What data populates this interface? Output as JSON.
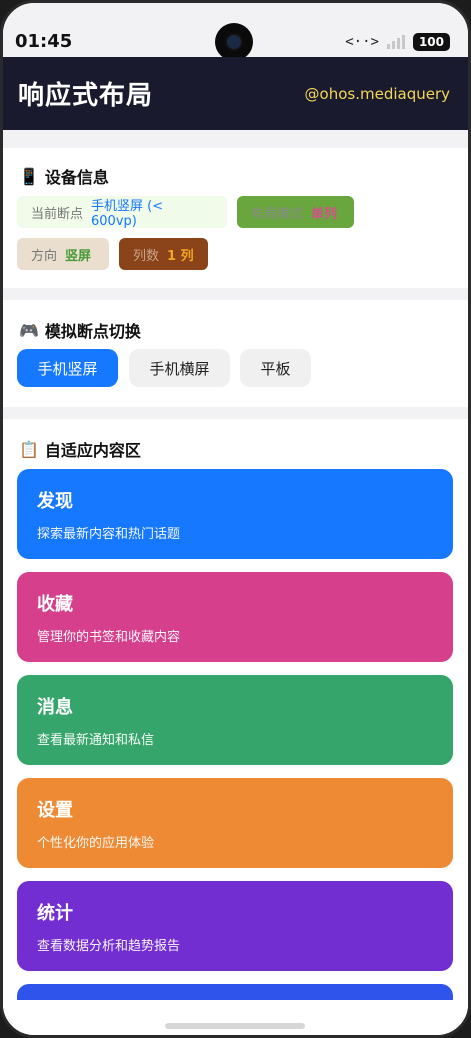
{
  "status": {
    "time": "01:45",
    "net_icon": "<··>",
    "signal_mark": "x",
    "battery": "100"
  },
  "header": {
    "title": "响应式布局",
    "subtitle": "@ohos.mediaquery"
  },
  "device_info": {
    "title": "设备信息",
    "icon": "phone-icon",
    "chips": [
      {
        "key": "当前断点",
        "value": "手机竖屏 (< 600vp)"
      },
      {
        "key": "布局模式",
        "value": "单列"
      },
      {
        "key": "方向",
        "value": "竖屏"
      },
      {
        "key": "列数",
        "value": "1 列"
      }
    ]
  },
  "breakpoint_switch": {
    "title": "模拟断点切换",
    "icon": "gamepad-icon",
    "buttons": [
      "手机竖屏",
      "手机横屏",
      "平板"
    ],
    "selected": "手机竖屏"
  },
  "adaptive": {
    "title": "自适应内容区",
    "icon": "clipboard-icon",
    "cards": [
      {
        "title": "发现",
        "desc": "探索最新内容和热门话题",
        "color": "#1677ff"
      },
      {
        "title": "收藏",
        "desc": "管理你的书签和收藏内容",
        "color": "#d63f8c"
      },
      {
        "title": "消息",
        "desc": "查看最新通知和私信",
        "color": "#36a56b"
      },
      {
        "title": "设置",
        "desc": "个性化你的应用体验",
        "color": "#ee8a33"
      },
      {
        "title": "统计",
        "desc": "查看数据分析和趋势报告",
        "color": "#722ed1"
      }
    ]
  }
}
